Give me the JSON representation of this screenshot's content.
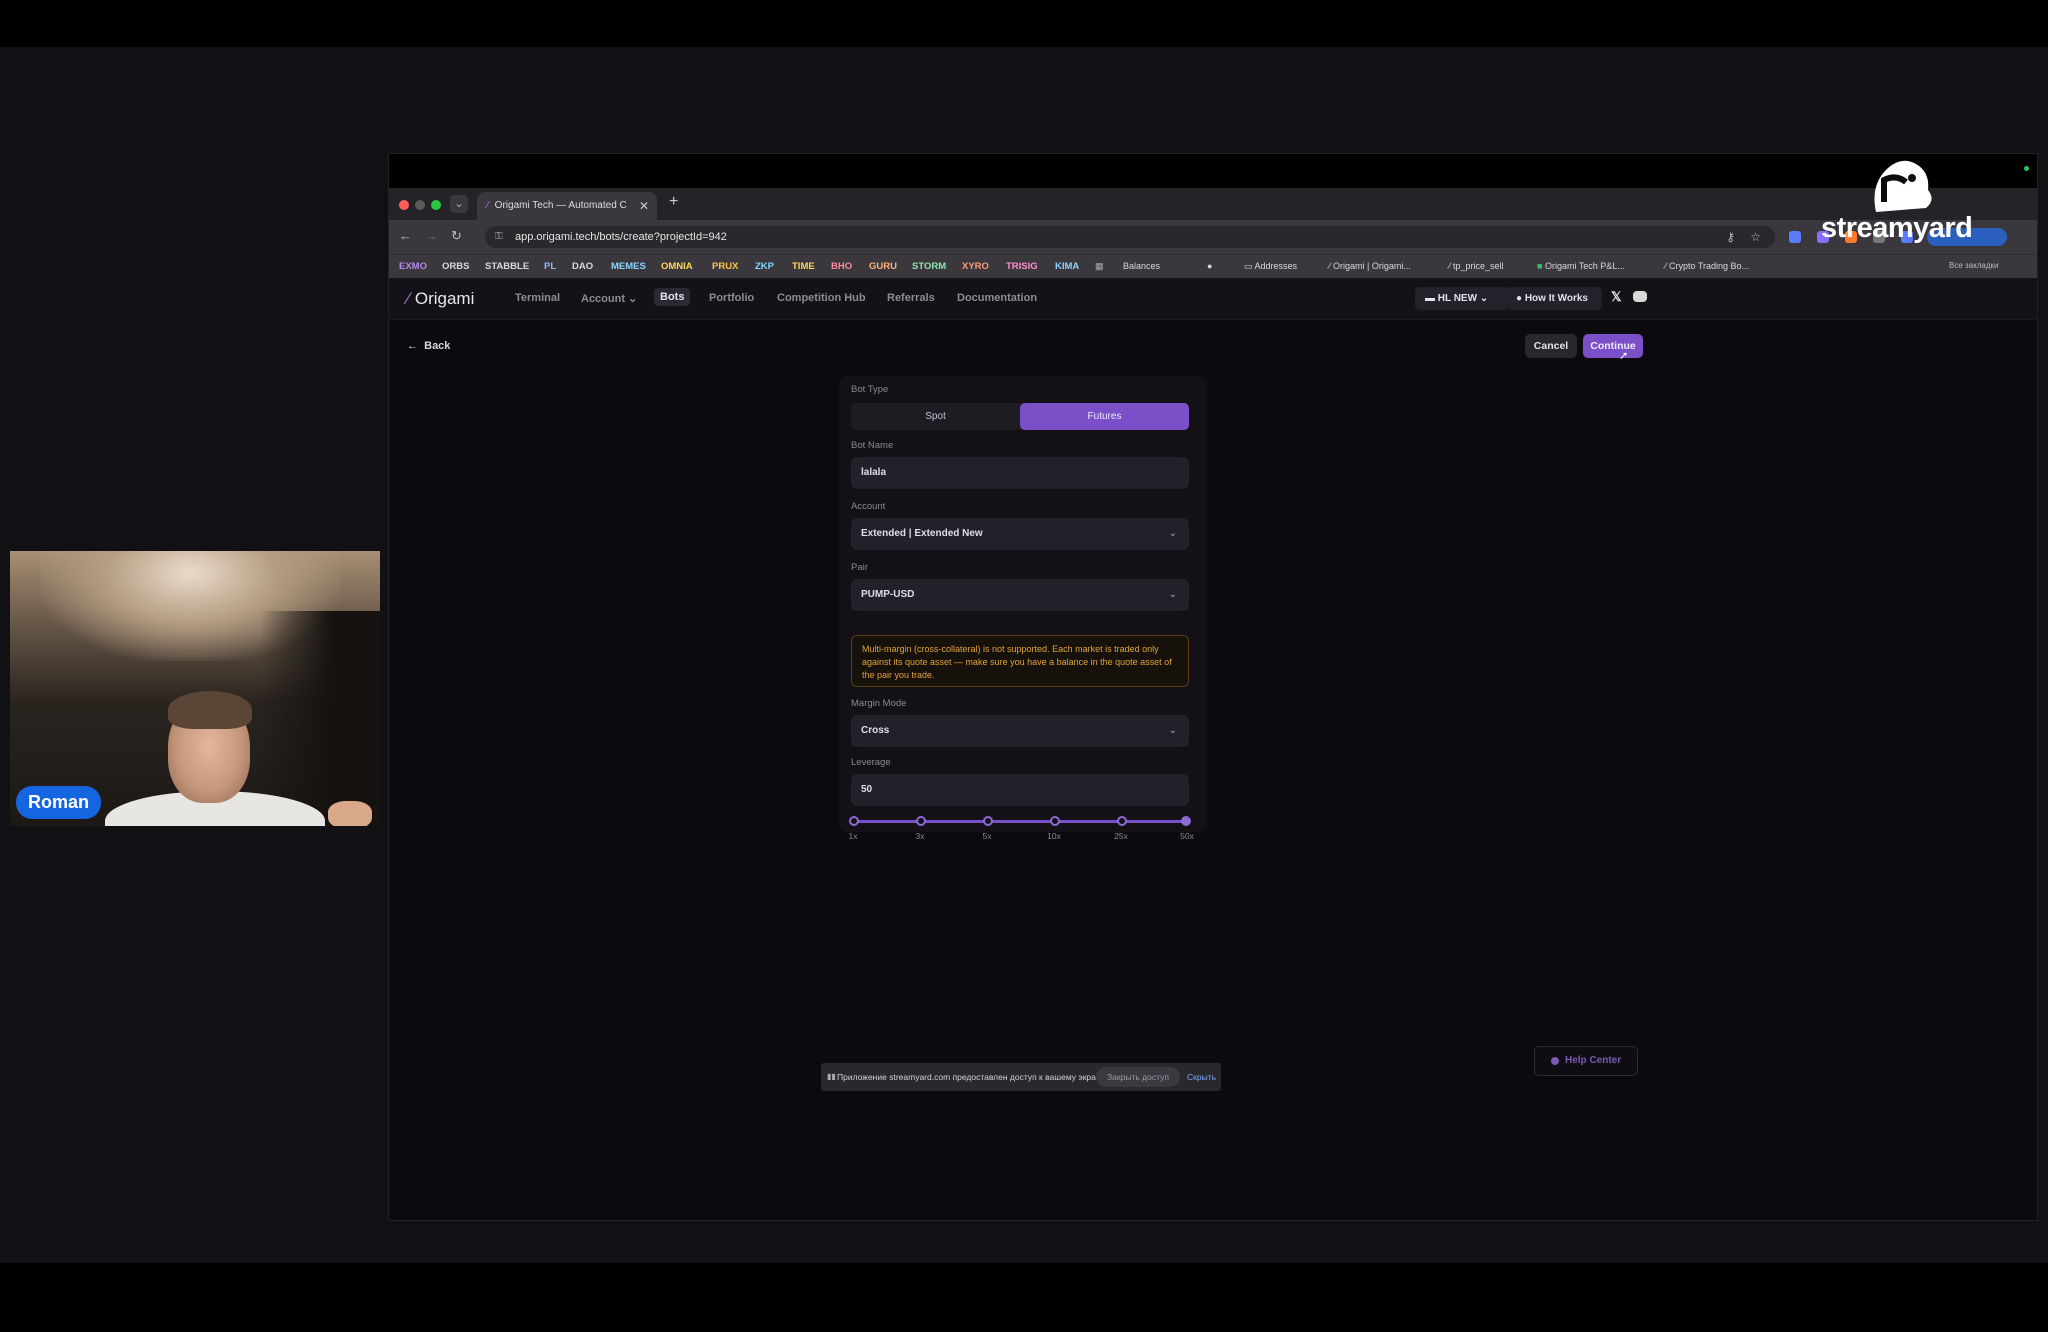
{
  "participant": {
    "name": "Roman"
  },
  "browser": {
    "tab_title": "Origami Tech — Automated C",
    "url": "app.origami.tech/bots/create?projectId=942",
    "bookmarks": [
      {
        "label": "EXMO",
        "color": "#b38cf0"
      },
      {
        "label": "ORBS",
        "color": "#d9d9d9"
      },
      {
        "label": "STABBLE",
        "color": "#d9d9d9"
      },
      {
        "label": "PL",
        "color": "#8fb4ff"
      },
      {
        "label": "DAO",
        "color": "#d9d9d9"
      },
      {
        "label": "MEMES",
        "color": "#8fd3ff"
      },
      {
        "label": "OMNIA",
        "color": "#ffd65a"
      },
      {
        "label": "PRUX",
        "color": "#ffc44d"
      },
      {
        "label": "ZKP",
        "color": "#7fd7ff"
      },
      {
        "label": "TIME",
        "color": "#ffd65a"
      },
      {
        "label": "BHO",
        "color": "#ff8aa0"
      },
      {
        "label": "GURU",
        "color": "#ffb27a"
      },
      {
        "label": "STORM",
        "color": "#8fe3b0"
      },
      {
        "label": "XYRO",
        "color": "#ff9b7a"
      },
      {
        "label": "TRISIG",
        "color": "#ff8fd1"
      },
      {
        "label": "KIMA",
        "color": "#8fd3ff"
      }
    ],
    "bookmarks_right": [
      "Balances",
      "Addresses",
      "Origami | Origami...",
      "tp_price_sell",
      "Origami Tech P&L...",
      "Crypto Trading Bo...",
      "Все закладки"
    ]
  },
  "streamyard": {
    "brand": "streamyard"
  },
  "app": {
    "logo": "Origami",
    "nav": [
      "Terminal",
      "Account",
      "Bots",
      "Portfolio",
      "Competition Hub",
      "Referrals",
      "Documentation"
    ],
    "active_nav": "Bots",
    "project_selector": "HL NEW",
    "how_it_works": "How It Works",
    "back": "Back",
    "cancel": "Cancel",
    "continue": "Continue"
  },
  "form": {
    "bot_type_label": "Bot Type",
    "bot_type_options": [
      "Spot",
      "Futures"
    ],
    "bot_type_selected": "Futures",
    "bot_name_label": "Bot Name",
    "bot_name_value": "lalala",
    "account_label": "Account",
    "account_value": "Extended | Extended New",
    "pair_label": "Pair",
    "pair_value": "PUMP-USD",
    "warning": "Multi-margin (cross-collateral) is not supported. Each market is traded only against its quote asset — make sure you have a balance in the quote asset of the pair you trade.",
    "margin_mode_label": "Margin Mode",
    "margin_mode_value": "Cross",
    "leverage_label": "Leverage",
    "leverage_value": "50",
    "leverage_ticks": [
      "1x",
      "3x",
      "5x",
      "10x",
      "25x",
      "50x"
    ]
  },
  "notification": {
    "text": "Приложение streamyard.com предоставлен доступ к вашему экрану.",
    "close": "Закрыть доступ",
    "hide": "Скрыть"
  },
  "help_center": "Help Center"
}
